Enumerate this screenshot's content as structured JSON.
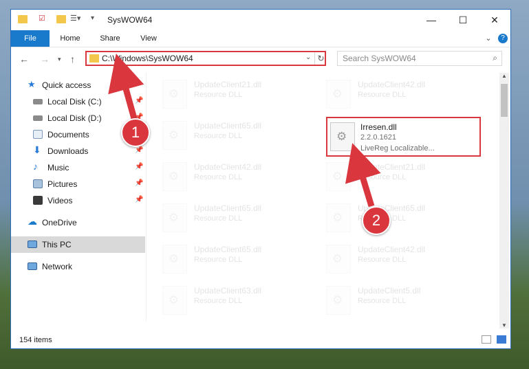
{
  "window": {
    "title": "SysWOW64"
  },
  "ribbon": {
    "tabs": [
      "File",
      "Home",
      "Share",
      "View"
    ]
  },
  "address": {
    "path": "C:\\Windows\\SysWOW64"
  },
  "search": {
    "placeholder": "Search SysWOW64"
  },
  "nav": {
    "items": [
      {
        "label": "Quick access"
      },
      {
        "label": "Local Disk (C:)"
      },
      {
        "label": "Local Disk (D:)"
      },
      {
        "label": "Documents"
      },
      {
        "label": "Downloads"
      },
      {
        "label": "Music"
      },
      {
        "label": "Pictures"
      },
      {
        "label": "Videos"
      },
      {
        "label": "OneDrive"
      },
      {
        "label": "This PC"
      },
      {
        "label": "Network"
      }
    ]
  },
  "files": [
    {
      "name": "UpdateClient21.dll",
      "type": "Resource DLL"
    },
    {
      "name": "UpdateClient42.dll",
      "type": "Resource DLL"
    },
    {
      "name": "UpdateClient65.dll",
      "type": "Resource DLL"
    },
    {
      "name": "Irresen.dll",
      "version": "2.2.0.1621",
      "description": "LiveReg Localizable..."
    },
    {
      "name": "UpdateClient42.dll",
      "type": "Resource DLL"
    },
    {
      "name": "UpdateClient21.dll",
      "type": "Resource DLL"
    },
    {
      "name": "UpdateClient65.dll",
      "type": "Resource DLL"
    },
    {
      "name": "UpdateClient65.dll",
      "type": "Resource DLL"
    },
    {
      "name": "UpdateClient65.dll",
      "type": "Resource DLL"
    },
    {
      "name": "UpdateClient42.dll",
      "type": "Resource DLL"
    },
    {
      "name": "UpdateClient63.dll",
      "type": "Resource DLL"
    },
    {
      "name": "UpdateClient5.dll",
      "type": "Resource DLL"
    }
  ],
  "status": {
    "count": "154 items"
  },
  "callouts": [
    "1",
    "2"
  ],
  "colors": {
    "accent": "#1979ca",
    "highlight": "#d9363e"
  }
}
